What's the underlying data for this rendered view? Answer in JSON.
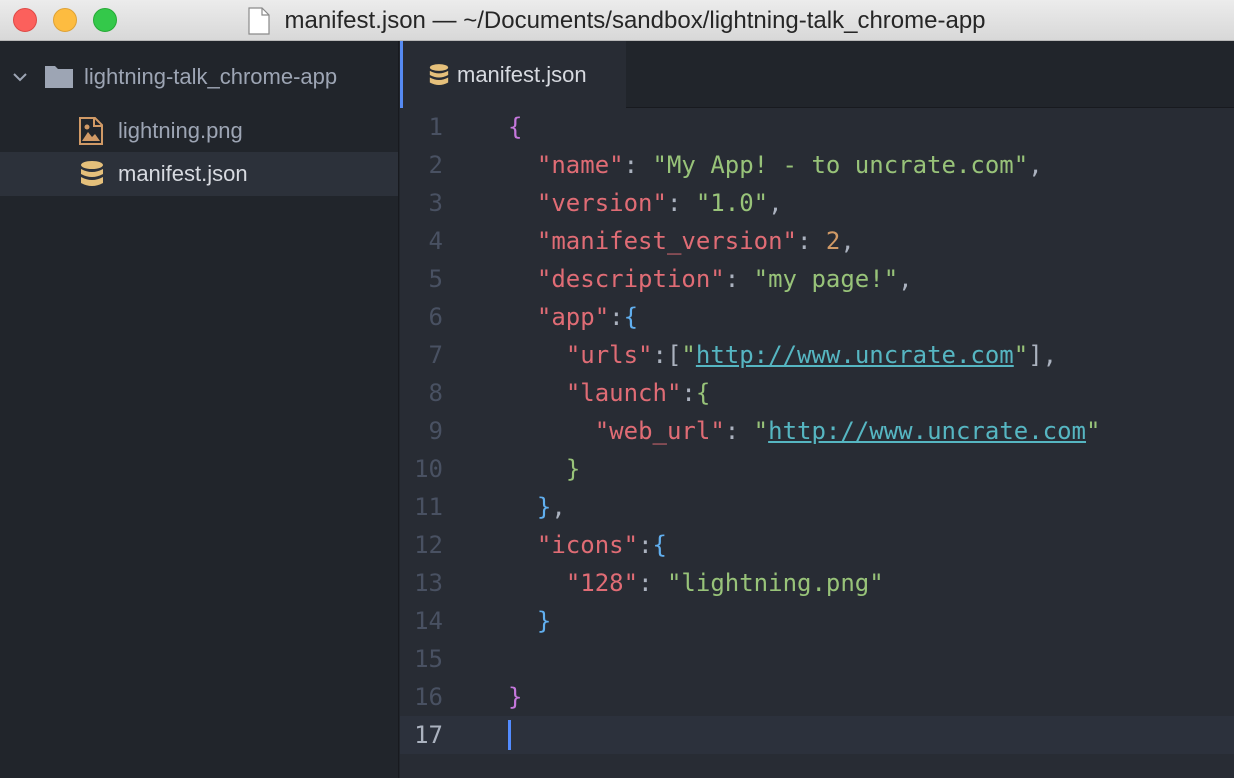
{
  "window": {
    "title": "manifest.json — ~/Documents/sandbox/lightning-talk_chrome-app"
  },
  "sidebar": {
    "project": "lightning-talk_chrome-app",
    "files": [
      {
        "name": "lightning.png",
        "icon": "image-file-icon"
      },
      {
        "name": "manifest.json",
        "icon": "database-file-icon"
      }
    ]
  },
  "tabs": [
    {
      "label": "manifest.json",
      "icon": "database-file-icon",
      "active": true
    }
  ],
  "editor": {
    "current_line": 17,
    "lines": [
      {
        "num": "1",
        "text": "{"
      },
      {
        "num": "2",
        "text": "  \"name\": \"My App! - to uncrate.com\","
      },
      {
        "num": "3",
        "text": "  \"version\": \"1.0\","
      },
      {
        "num": "4",
        "text": "  \"manifest_version\": 2,"
      },
      {
        "num": "5",
        "text": "  \"description\": \"my page!\","
      },
      {
        "num": "6",
        "text": "  \"app\":{"
      },
      {
        "num": "7",
        "text": "    \"urls\":[\"http://www.uncrate.com\"],"
      },
      {
        "num": "8",
        "text": "    \"launch\":{"
      },
      {
        "num": "9",
        "text": "      \"web_url\": \"http://www.uncrate.com\""
      },
      {
        "num": "10",
        "text": "    }"
      },
      {
        "num": "11",
        "text": "  },"
      },
      {
        "num": "12",
        "text": "  \"icons\":{"
      },
      {
        "num": "13",
        "text": "    \"128\": \"lightning.png\""
      },
      {
        "num": "14",
        "text": "  }"
      },
      {
        "num": "15",
        "text": ""
      },
      {
        "num": "16",
        "text": "}"
      },
      {
        "num": "17",
        "text": ""
      }
    ]
  },
  "colors": {
    "accent": "#568af2",
    "key": "#e06c75",
    "string": "#98c379",
    "number": "#d19a66",
    "link": "#56b6c2"
  }
}
